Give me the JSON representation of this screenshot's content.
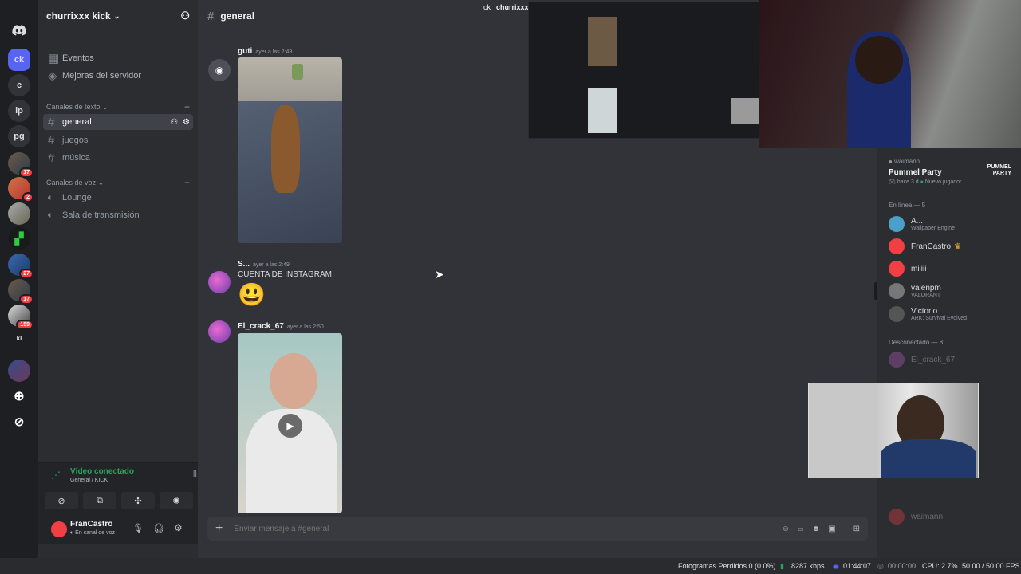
{
  "servers": [
    {
      "label": "",
      "icon": "discord-icon",
      "active": false
    },
    {
      "label": "ck",
      "active": true
    },
    {
      "label": "c"
    },
    {
      "label": "lp"
    },
    {
      "label": "pg"
    },
    {
      "label": "",
      "badge": "17"
    },
    {
      "label": "",
      "badge": "2"
    },
    {
      "label": ""
    },
    {
      "label": ""
    },
    {
      "label": "",
      "badge": "27"
    },
    {
      "label": "",
      "badge": "17"
    },
    {
      "label": "",
      "badge": "159"
    },
    {
      "label": "kl"
    },
    {
      "label": ""
    }
  ],
  "sidebar": {
    "server_name": "churrixxx kick",
    "events": "Eventos",
    "boosts": "Mejoras del servidor",
    "text_category": "Canales de texto",
    "text_channels": [
      "general",
      "juegos",
      "música"
    ],
    "voice_category": "Canales de voz",
    "voice_channels": [
      "Lounge",
      "Sala de transmisión"
    ]
  },
  "voice_panel": {
    "status": "Vídeo conectado",
    "location": "General / KICK"
  },
  "user_panel": {
    "name": "FranCastro",
    "status": "En canal de voz"
  },
  "channel": {
    "name": "general"
  },
  "messages": [
    {
      "author": "guti",
      "time": "ayer a las 2:49"
    },
    {
      "author": "S...",
      "time": "ayer a las 2:49",
      "text": "CUENTA DE INSTAGRAM",
      "emoji": "😃"
    },
    {
      "author": "El_crack_67",
      "time": "ayer a las 2:50"
    }
  ],
  "composer": {
    "placeholder": "Enviar mensaje a #general"
  },
  "activity": {
    "user": "waimann",
    "game": "Pummel Party",
    "detail": "hace 3 d",
    "tag": "Nuevo jugador",
    "logo": "PUMMEL PARTY"
  },
  "members": {
    "online_header": "En línea — 5",
    "online": [
      {
        "name": "A...",
        "sub": "Wallpaper Engine"
      },
      {
        "name": "FranCastro",
        "sub": ""
      },
      {
        "name": "miliii",
        "sub": ""
      },
      {
        "name": "valenpm",
        "sub": "VALORANT"
      },
      {
        "name": "Victorio",
        "sub": "ARK: Survival Evolved"
      }
    ],
    "offline_header": "Desconectado — 8",
    "offline": [
      {
        "name": "El_crack_67"
      },
      {
        "name": "waimann"
      }
    ]
  },
  "overlay_title": "churrixxx",
  "overlay_ck": "ck",
  "statusbar": {
    "dropped": "Fotogramas Perdidos 0 (0.0%)",
    "bitrate": "8287 kbps",
    "time1": "01:44:07",
    "time2": "00:00:00",
    "cpu": "CPU: 2.7%",
    "fps": "50.00 / 50.00 FPS"
  },
  "colors": {
    "accent": "#5865f2",
    "online": "#23a55a",
    "danger": "#f23f43",
    "voice": "#23a55a"
  }
}
